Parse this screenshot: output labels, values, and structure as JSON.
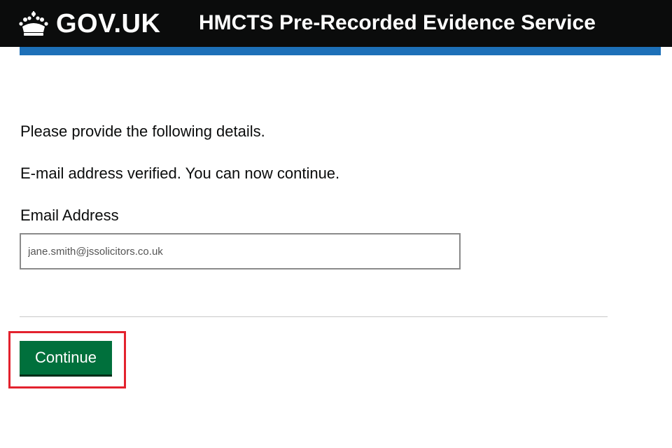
{
  "header": {
    "logo_text": "GOV.UK",
    "service_name": "HMCTS Pre-Recorded Evidence Service"
  },
  "main": {
    "intro_text": "Please provide the following details.",
    "verified_text": "E-mail address verified. You can now continue.",
    "email_label": "Email Address",
    "email_value": "jane.smith@jssolicitors.co.uk",
    "continue_label": "Continue"
  },
  "colors": {
    "header_bg": "#0b0c0c",
    "blue_bar": "#1d70b8",
    "button_green": "#00703c",
    "highlight_red": "#e3222e"
  },
  "icons": {
    "logo": "crown-icon"
  }
}
